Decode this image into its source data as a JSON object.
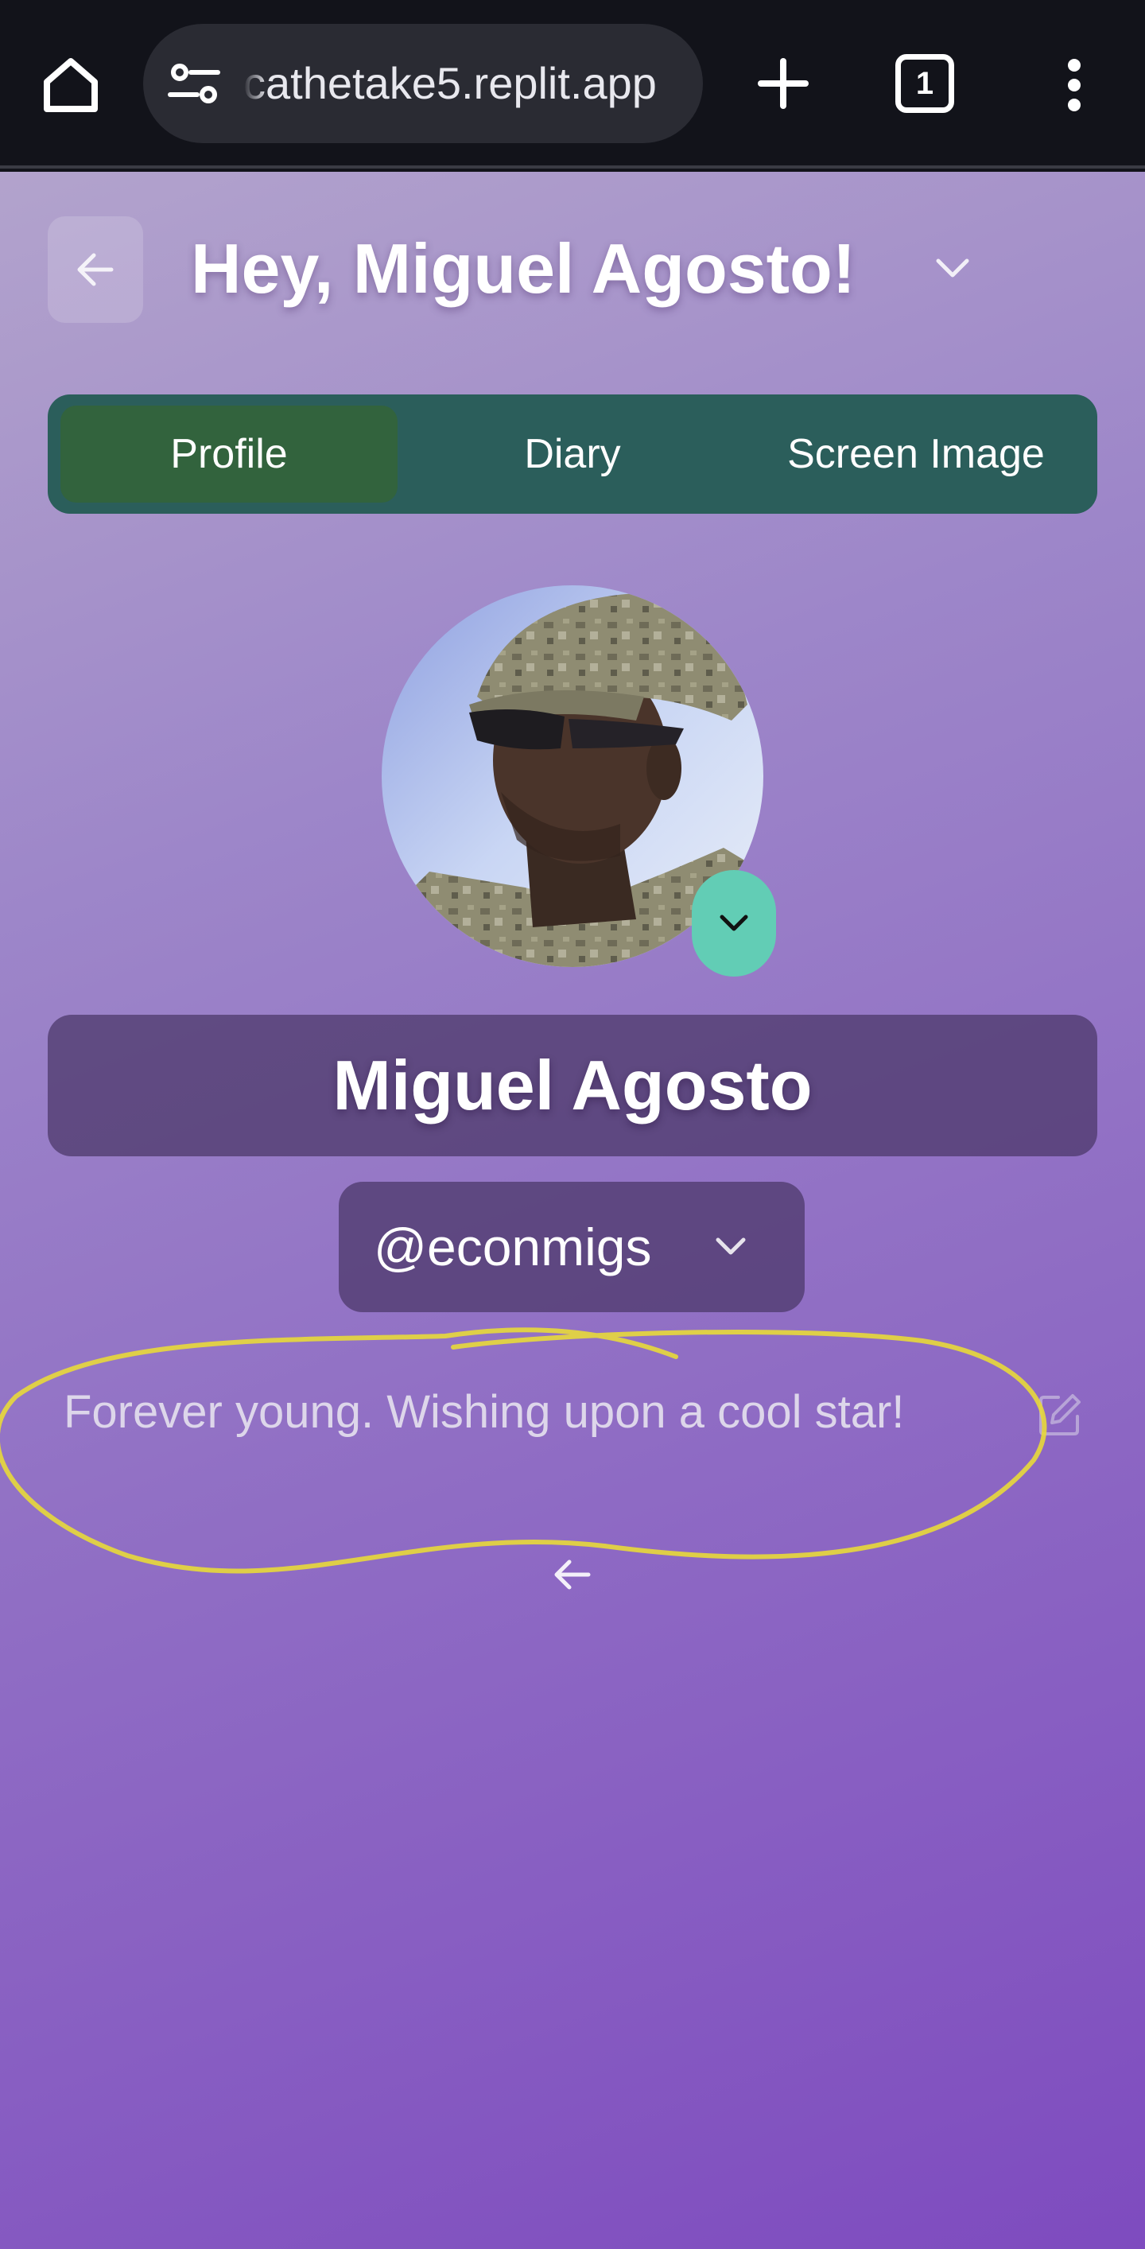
{
  "browser": {
    "url": "cathetake5.replit.app",
    "tab_count": "1",
    "icons": [
      "home-icon",
      "site-settings-icon",
      "plus-icon",
      "tab-switcher-icon",
      "more-vert-icon"
    ]
  },
  "header": {
    "greeting": "Hey, Miguel Agosto!"
  },
  "tabs": [
    {
      "label": "Profile",
      "active": true
    },
    {
      "label": "Diary",
      "active": false
    },
    {
      "label": "Screen Image",
      "active": false
    }
  ],
  "profile": {
    "name": "Miguel Agosto",
    "handle": "@econmigs",
    "bio": "Forever young. Wishing upon a cool star!"
  },
  "colors": {
    "tab_bar": "#2b5e5b",
    "active_tab": "#32633d",
    "avatar_toggle": "#62cdb5",
    "annotation_stroke": "#e8d93a",
    "card_background": "#4a3666"
  }
}
